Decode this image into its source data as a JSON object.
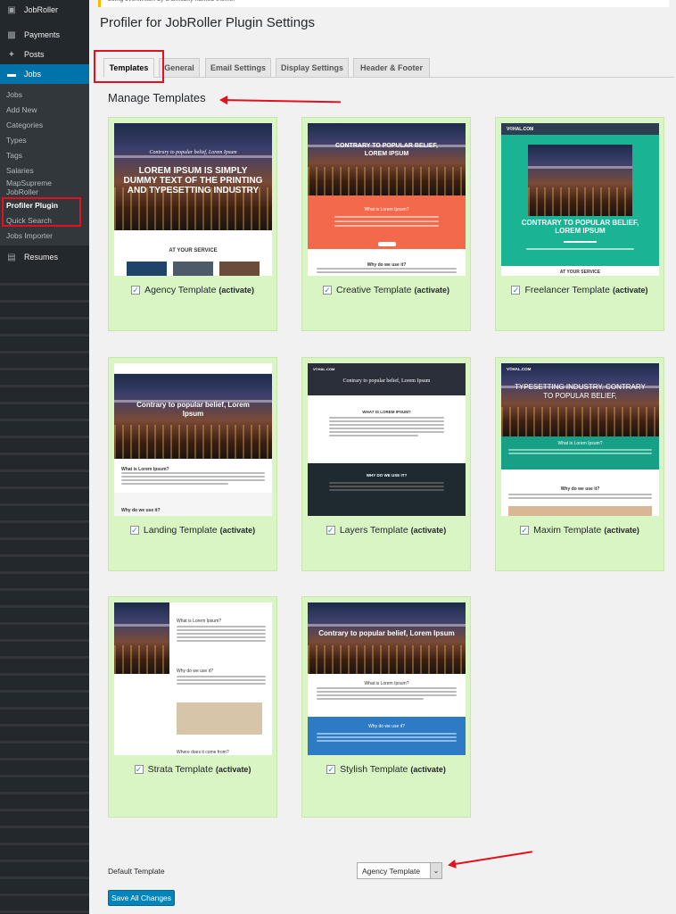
{
  "sidebar": {
    "top": [
      {
        "label": "JobRoller",
        "icon": "jobroller-icon"
      },
      {
        "label": "Payments",
        "icon": "payments-icon"
      },
      {
        "label": "Posts",
        "icon": "pin-icon"
      },
      {
        "label": "Jobs",
        "icon": "folder-icon"
      }
    ],
    "jobs_submenu": [
      "Jobs",
      "Add New",
      "Categories",
      "Types",
      "Tags",
      "Salaries",
      "MapSupreme JobRoller",
      "Profiler Plugin",
      "Quick Search",
      "Jobs Importer"
    ],
    "after": {
      "label": "Resumes",
      "icon": "resumes-icon"
    }
  },
  "notice": "being overwritten by a similarly named theme.",
  "page_title": "Profiler for JobRoller Plugin Settings",
  "tabs": [
    "Templates",
    "General",
    "Email Settings",
    "Display Settings",
    "Header & Footer"
  ],
  "section_title": "Manage Templates",
  "templates": [
    {
      "name": "Agency Template",
      "action": "(activate)",
      "hero": "LOREM IPSUM IS SIMPLY DUMMY TEXT OF THE PRINTING AND TYPESETTING INDUSTRY",
      "sub": "Contrary to popular belief, Lorem Ipsum",
      "band": "AT YOUR SERVICE"
    },
    {
      "name": "Creative Template",
      "action": "(activate)",
      "hero": "CONTRARY TO POPULAR BELIEF, LOREM IPSUM",
      "sub": "What is Lorem Ipsum?",
      "band": "Why do we use it?"
    },
    {
      "name": "Freelancer Template",
      "action": "(activate)",
      "hero": "CONTRARY TO POPULAR BELIEF, LOREM IPSUM",
      "logo": "V©HAL.COM",
      "band": "AT YOUR SERVICE"
    },
    {
      "name": "Landing Template",
      "action": "(activate)",
      "hero": "Contrary to popular belief, Lorem Ipsum",
      "sub": "What is Lorem Ipsum?",
      "band": "Why do we use it?"
    },
    {
      "name": "Layers Template",
      "action": "(activate)",
      "hero": "Contrary to popular belief, Lorem Ipsum",
      "logo": "V©HAL.COM",
      "sub": "WHAT IS LOREM IPSUM?",
      "band": "WHY DO WE USE IT?"
    },
    {
      "name": "Maxim Template",
      "action": "(activate)",
      "hero": "TYPESETTING INDUSTRY. CONTRARY TO POPULAR BELIEF,",
      "logo": "V©HAL.COM",
      "sub": "What is Lorem Ipsum?",
      "band": "Why do we use it?"
    },
    {
      "name": "Strata Template",
      "action": "(activate)",
      "sub": "What is Lorem Ipsum?",
      "band": "Why do we use it?",
      "band2": "Where does it come from?"
    },
    {
      "name": "Stylish Template",
      "action": "(activate)",
      "hero": "Contrary to popular belief, Lorem Ipsum",
      "sub": "What is Lorem Ipsum?",
      "band": "Why do we use it?"
    }
  ],
  "default_template": {
    "label": "Default Template",
    "value": "Agency Template"
  },
  "save_button": "Save All Changes",
  "colors": {
    "sidebar": "#23282d",
    "accent": "#0073aa",
    "card": "#d9f5c3",
    "highlight": "#e3101e"
  }
}
